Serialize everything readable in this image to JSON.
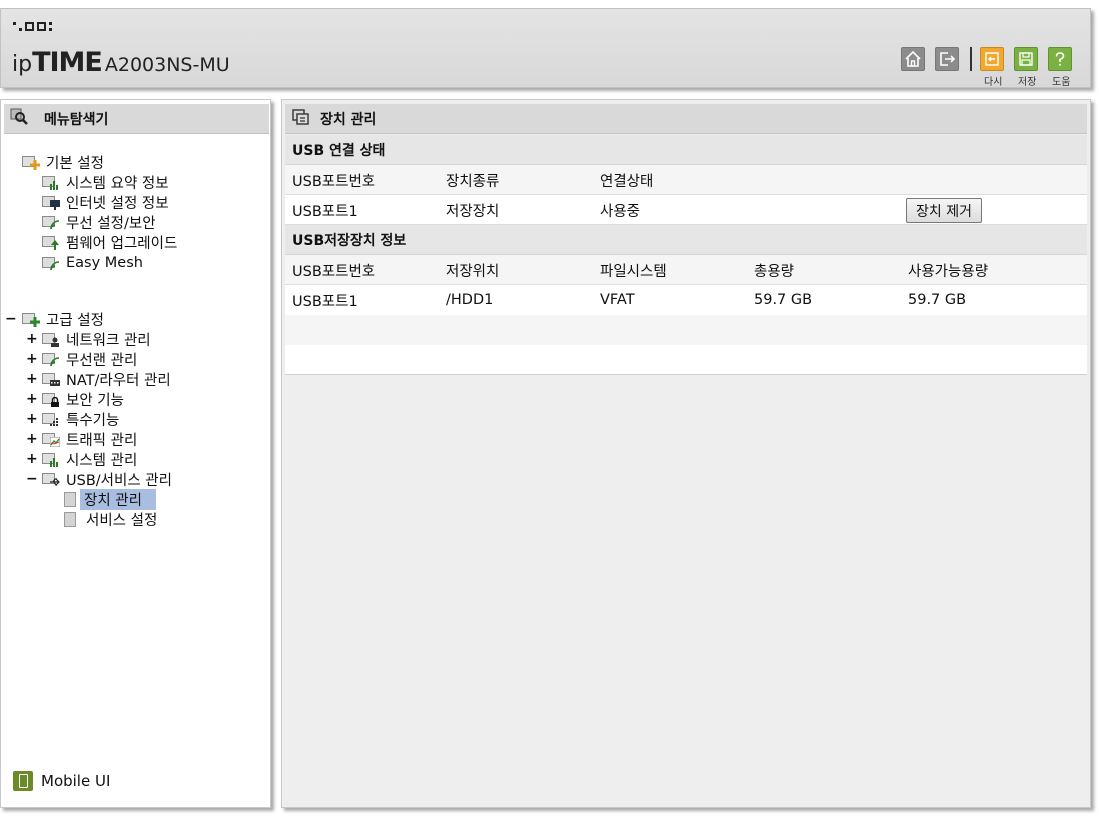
{
  "header": {
    "logo_ip": "ip",
    "logo_time": "TIME",
    "model": "A2003NS-MU",
    "toolbar": {
      "home_icon": "home-icon",
      "logout_icon": "logout-icon",
      "reload_label": "다시",
      "save_label": "저장",
      "help_label": "도움"
    }
  },
  "sidebar": {
    "title": "메뉴탐색기",
    "basic": {
      "label": "기본 설정",
      "items": [
        "시스템 요약 정보",
        "인터넷 설정 정보",
        "무선 설정/보안",
        "펌웨어 업그레이드",
        "Easy Mesh"
      ]
    },
    "advanced": {
      "label": "고급 설정",
      "expander": "−",
      "items": [
        {
          "label": "네트워크 관리",
          "expander": "+"
        },
        {
          "label": "무선랜 관리",
          "expander": "+"
        },
        {
          "label": "NAT/라우터 관리",
          "expander": "+"
        },
        {
          "label": "보안 기능",
          "expander": "+"
        },
        {
          "label": "특수기능",
          "expander": "+"
        },
        {
          "label": "트래픽 관리",
          "expander": "+"
        },
        {
          "label": "시스템 관리",
          "expander": "+"
        },
        {
          "label": "USB/서비스 관리",
          "expander": "−"
        }
      ],
      "usb_children": [
        "장치 관리",
        "서비스 설정"
      ]
    },
    "mobile_ui": "Mobile UI"
  },
  "main": {
    "title": "장치 관리",
    "usb_status": {
      "title": "USB 연결 상태",
      "headers": [
        "USB포트번호",
        "장치종류",
        "연결상태"
      ],
      "row": [
        "USB포트1",
        "저장장치",
        "사용중"
      ],
      "remove_button": "장치 제거"
    },
    "storage_info": {
      "title": "USB저장장치 정보",
      "headers": [
        "USB포트번호",
        "저장위치",
        "파일시스템",
        "총용량",
        "사용가능용량"
      ],
      "row": [
        "USB포트1",
        "/HDD1",
        "VFAT",
        "59.7 GB",
        "59.7 GB"
      ]
    }
  }
}
